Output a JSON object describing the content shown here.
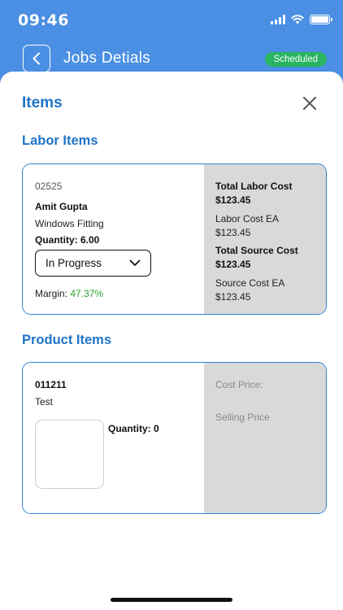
{
  "status_bar": {
    "time": "09:46"
  },
  "header": {
    "title": "Jobs Detials",
    "status_badge": "Scheduled"
  },
  "sheet": {
    "title": "Items"
  },
  "labor_section": {
    "title": "Labor Items",
    "item": {
      "code": "02525",
      "name": "Amit Gupta",
      "description": "Windows Fitting",
      "quantity": "Quantity: 6.00",
      "status": "In Progress",
      "margin_label": "Margin:",
      "margin_value": "47.37%",
      "total_labor_cost_label": "Total Labor Cost",
      "total_labor_cost": "$123.45",
      "labor_cost_ea_label": "Labor Cost EA",
      "labor_cost_ea": "$123.45",
      "total_source_cost_label": "Total Source Cost",
      "total_source_cost": "$123.45",
      "source_cost_ea_label": "Source Cost EA",
      "source_cost_ea": "$123.45"
    }
  },
  "product_section": {
    "title": "Product Items",
    "item": {
      "code": "011211",
      "name": "Test",
      "quantity": "Quantity: 0",
      "cost_price_label": "Cost Price:",
      "selling_price_label": "Selling Price"
    }
  },
  "colors": {
    "primary_blue": "#4a8fe3",
    "heading_blue": "#1f74c9",
    "badge_green": "#28b463",
    "margin_green": "#2e9e2e",
    "panel_grey": "#d9d9d9"
  },
  "icons": {
    "back": "chevron-left-icon",
    "close": "close-icon",
    "dropdown": "chevron-down-icon"
  }
}
